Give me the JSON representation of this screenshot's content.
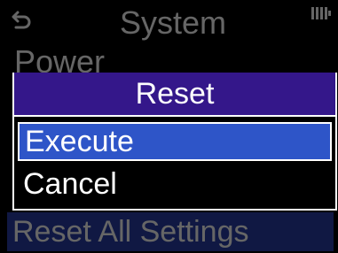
{
  "header": {
    "title": "System",
    "back_icon": "back-arrow-icon",
    "battery_icon": "battery-icon"
  },
  "background_menu": {
    "items": [
      {
        "label": "Power"
      },
      {
        "label": "Reset All Settings",
        "selected": true
      }
    ]
  },
  "dialog": {
    "title": "Reset",
    "options": [
      {
        "label": "Execute",
        "selected": true
      },
      {
        "label": "Cancel",
        "selected": false
      }
    ]
  },
  "colors": {
    "background": "#000000",
    "dialog_title_bg": "#34178a",
    "selection_bg": "#2e55c8",
    "text": "#ffffff"
  }
}
